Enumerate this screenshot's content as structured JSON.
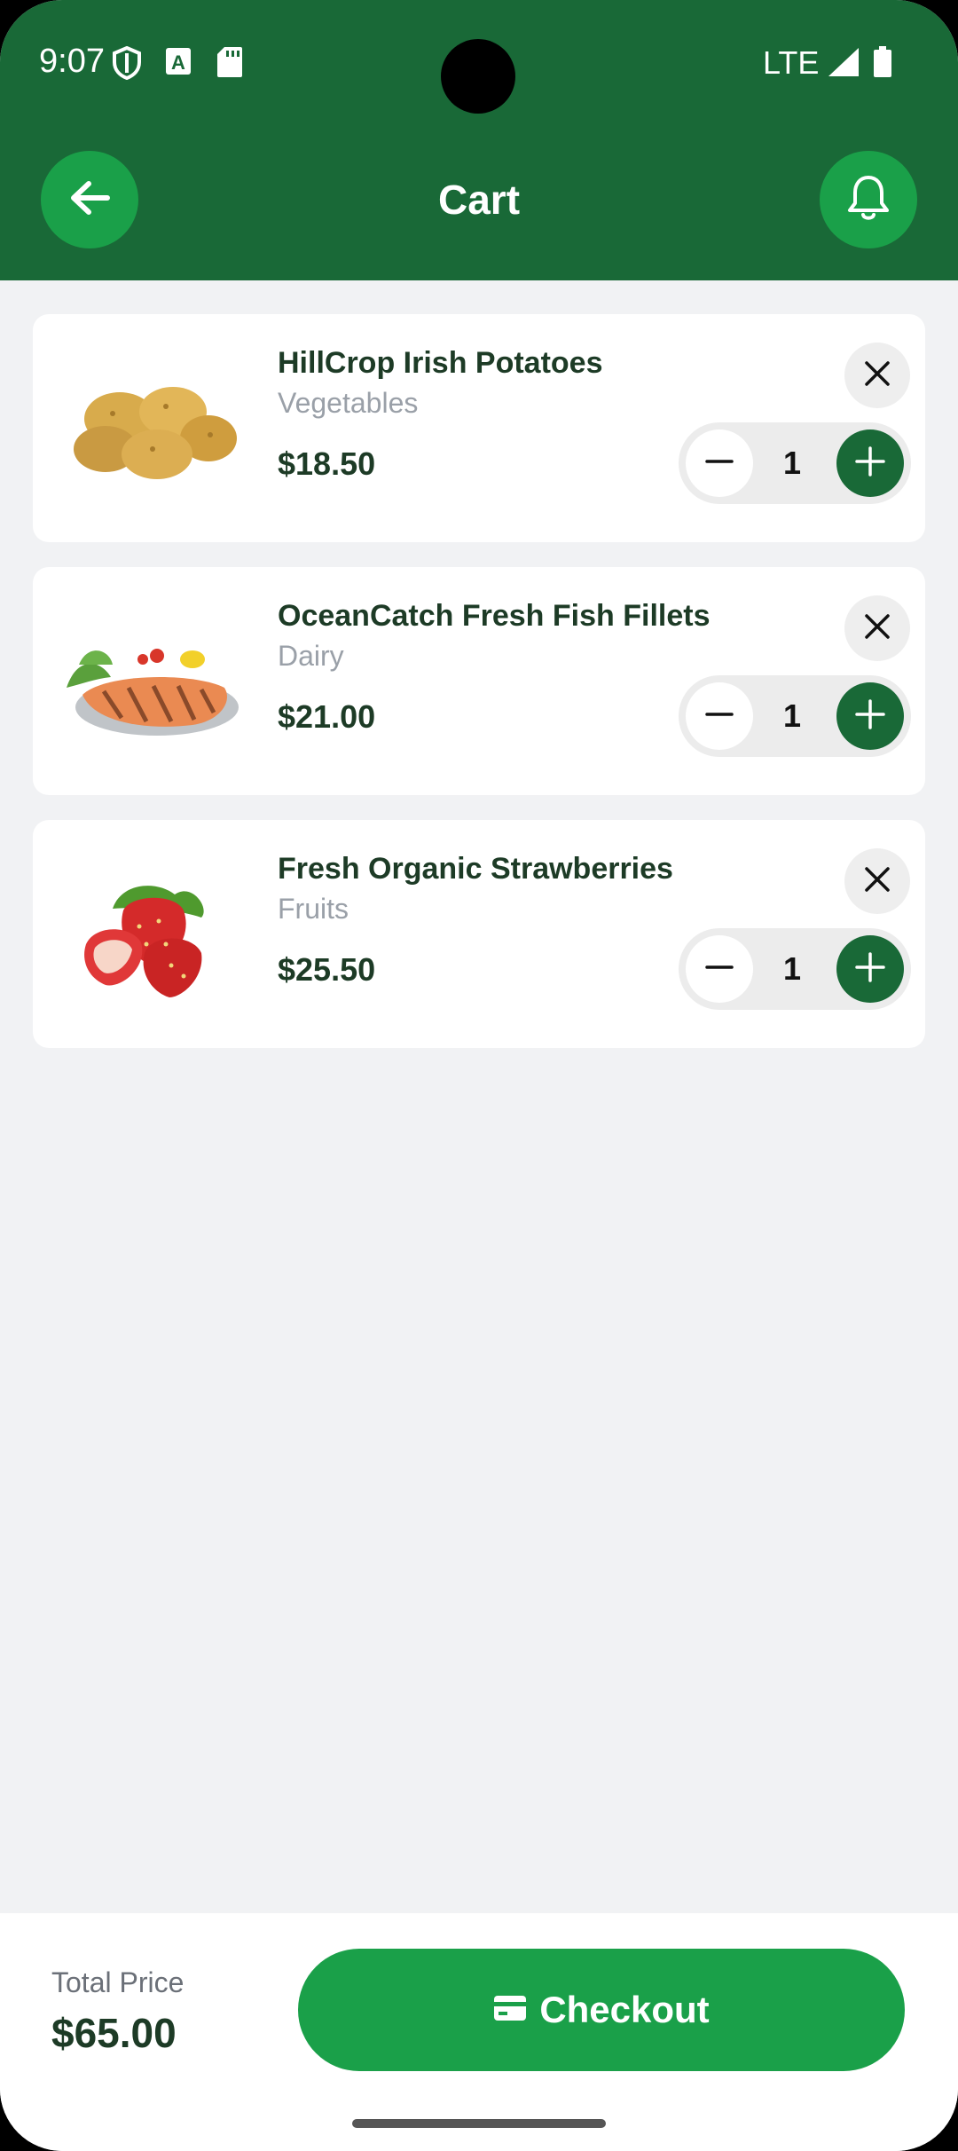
{
  "status_bar": {
    "time": "9:07",
    "network": "LTE"
  },
  "header": {
    "title": "Cart"
  },
  "cart": {
    "items": [
      {
        "name": "HillCrop Irish Potatoes",
        "category": "Vegetables",
        "price": "$18.50",
        "quantity": "1"
      },
      {
        "name": "OceanCatch Fresh Fish Fillets",
        "category": "Dairy",
        "price": "$21.00",
        "quantity": "1"
      },
      {
        "name": "Fresh Organic Strawberries",
        "category": "Fruits",
        "price": "$25.50",
        "quantity": "1"
      }
    ]
  },
  "footer": {
    "total_label": "Total Price",
    "total_value": "$65.00",
    "checkout_label": "Checkout"
  },
  "colors": {
    "header": "#196937",
    "accent": "#1aa049",
    "background": "#f1f2f4"
  },
  "icons": [
    "back-arrow-icon",
    "bell-icon",
    "close-icon",
    "minus-icon",
    "plus-icon",
    "card-icon"
  ]
}
